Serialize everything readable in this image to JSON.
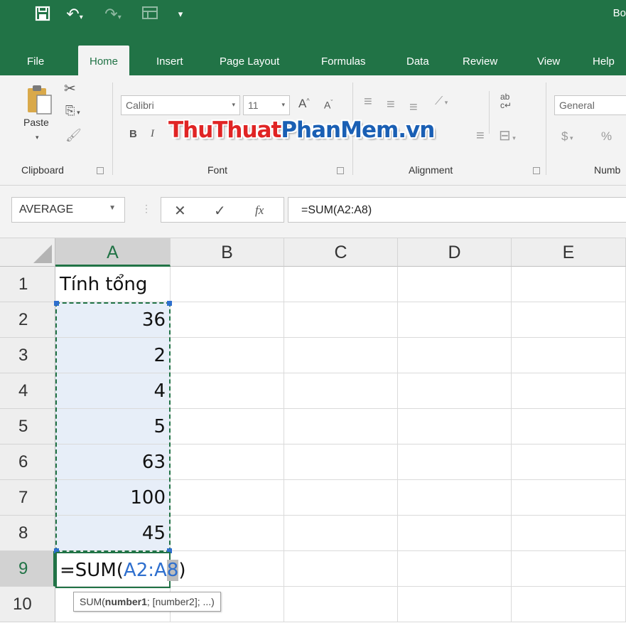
{
  "app": {
    "book_title": "Bo",
    "accent": "#217346",
    "selection_color": "#2e6fce"
  },
  "quick_access": {
    "icons": [
      "save-icon",
      "undo-icon",
      "redo-icon",
      "form-icon",
      "customize-icon"
    ]
  },
  "tabs": [
    {
      "label": "File"
    },
    {
      "label": "Home",
      "active": true
    },
    {
      "label": "Insert"
    },
    {
      "label": "Page Layout"
    },
    {
      "label": "Formulas"
    },
    {
      "label": "Data"
    },
    {
      "label": "Review"
    },
    {
      "label": "View"
    },
    {
      "label": "Help"
    }
  ],
  "ribbon": {
    "clipboard": {
      "label": "Clipboard",
      "paste_label": "Paste"
    },
    "font": {
      "label": "Font",
      "name": "Calibri",
      "size": "11",
      "bold": "B",
      "italic": "I"
    },
    "alignment": {
      "label": "Alignment"
    },
    "number": {
      "label": "Numb",
      "format": "General",
      "currency": "$",
      "percent": "%"
    }
  },
  "watermark": {
    "part1": "ThuThuat",
    "part2": "PhanMem",
    "part3": ".vn",
    "color1": "#e02424",
    "color2": "#1a5fb4"
  },
  "formula_bar": {
    "name_box": "AVERAGE",
    "cancel": "✕",
    "enter": "✓",
    "fx": "fx",
    "formula": "=SUM(A2:A8)"
  },
  "columns": [
    "A",
    "B",
    "C",
    "D",
    "E"
  ],
  "rows": [
    {
      "num": "1",
      "a": "Tính tổng"
    },
    {
      "num": "2",
      "a": "36"
    },
    {
      "num": "3",
      "a": "2"
    },
    {
      "num": "4",
      "a": "4"
    },
    {
      "num": "5",
      "a": "5"
    },
    {
      "num": "6",
      "a": "63"
    },
    {
      "num": "7",
      "a": "100"
    },
    {
      "num": "8",
      "a": "45"
    },
    {
      "num": "9",
      "a": ""
    },
    {
      "num": "10",
      "a": ""
    }
  ],
  "editing": {
    "prefix": "=SUM(",
    "ref_start": "A2:A",
    "ref_selected": "8",
    "suffix": ")"
  },
  "tooltip": {
    "fn": "SUM(",
    "arg1": "number1",
    "rest": "; [number2]; ...)"
  }
}
